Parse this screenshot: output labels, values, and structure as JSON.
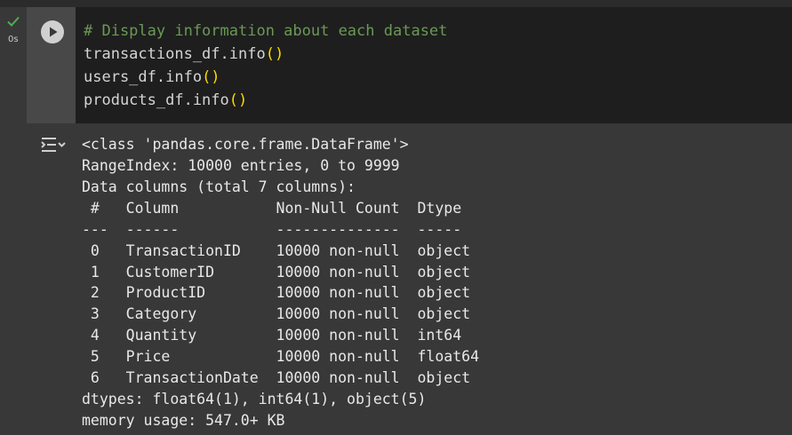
{
  "cell": {
    "status": "success",
    "exec_time": "0s",
    "code_comment": "# Display information about each dataset",
    "code_lines": [
      {
        "text": "transactions_df.info",
        "parens": "()"
      },
      {
        "text": "users_df.info",
        "parens": "()"
      },
      {
        "text": "products_df.info",
        "parens": "()"
      }
    ]
  },
  "output": {
    "lines": [
      "<class 'pandas.core.frame.DataFrame'>",
      "RangeIndex: 10000 entries, 0 to 9999",
      "Data columns (total 7 columns):",
      " #   Column           Non-Null Count  Dtype  ",
      "---  ------           --------------  -----  ",
      " 0   TransactionID    10000 non-null  object ",
      " 1   CustomerID       10000 non-null  object ",
      " 2   ProductID        10000 non-null  object ",
      " 3   Category         10000 non-null  object ",
      " 4   Quantity         10000 non-null  int64  ",
      " 5   Price            10000 non-null  float64",
      " 6   TransactionDate  10000 non-null  object ",
      "dtypes: float64(1), int64(1), object(5)",
      "memory usage: 547.0+ KB"
    ]
  },
  "icons": {
    "status": "check-icon",
    "run": "play-icon",
    "output_menu": "output-actions-icon"
  },
  "colors": {
    "success": "#4caf50",
    "comment": "#6a9955",
    "paren": "#ffd700",
    "code_bg": "#1e1e1e"
  }
}
